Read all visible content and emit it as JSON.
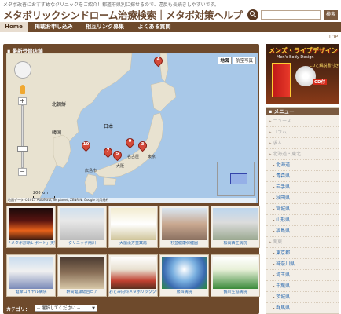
{
  "header": {
    "tagline": "メタボ改善におすすめなクリニックをご紹介！都道府県別に探せるので、違反も長続きしやすいです。",
    "site_title": "メタボリックシンドローム治療検索｜メタボ対策ヘルプ",
    "search": {
      "placeholder": "",
      "button_label": "検索"
    }
  },
  "nav": {
    "items": [
      {
        "label": "Home",
        "active": true
      },
      {
        "label": "掲載お申し込み",
        "active": false
      },
      {
        "label": "相互リンク募集",
        "active": false
      },
      {
        "label": "よくある質問",
        "active": false
      }
    ],
    "top_link": "TOP"
  },
  "main": {
    "panel_title": "最新登録店舗",
    "map": {
      "type_buttons": {
        "map": "地図",
        "satellite": "航空写真"
      },
      "labels": {
        "north_korea": "北朝鮮",
        "korea": "韓国",
        "japan": "日本",
        "tokyo": "東京",
        "osaka": "大阪",
        "nagoya": "名古屋",
        "hiroshima": "広島市"
      },
      "markers": [
        "4",
        "10",
        "7",
        "5",
        "9",
        "3"
      ],
      "scale": "200 km",
      "attribution": "地図データ ©2013 AutoNavi, SK planet, ZENRIN, Google 利用規約"
    },
    "thumbnails": [
      {
        "caption": "「メタボ診断レポート」美容ヘルス院"
      },
      {
        "caption": "クリニック南川"
      },
      {
        "caption": "大船漢方堂薬局"
      },
      {
        "caption": "杉並健康保健園"
      },
      {
        "caption": "松岡西生病院"
      },
      {
        "caption": "健幸ロイヤル病院"
      },
      {
        "caption": "幹高健康総合ビア"
      },
      {
        "caption": "おとみ内科メタボリッククリニック"
      },
      {
        "caption": "熊四病院"
      },
      {
        "caption": "鶴川生協病院"
      }
    ],
    "category": {
      "label": "カテゴリ：",
      "selected": "-- 選択してください --"
    }
  },
  "sidebar": {
    "banner": {
      "title": "メンズ・ライブデザイン",
      "subtitle": "Men's Body Design",
      "cd_label": "CDと解説書付き",
      "badge": "CD付"
    },
    "menu_title": "メニュー",
    "menu_items": [
      {
        "label": "ニュース",
        "level": 1
      },
      {
        "label": "コラム",
        "level": 1
      },
      {
        "label": "求人",
        "level": 1
      },
      {
        "label": "北海道・東北",
        "level": 1
      },
      {
        "label": "北海道",
        "level": 2
      },
      {
        "label": "青森県",
        "level": 2
      },
      {
        "label": "岩手県",
        "level": 2
      },
      {
        "label": "秋田県",
        "level": 2
      },
      {
        "label": "宮城県",
        "level": 2
      },
      {
        "label": "山形県",
        "level": 2
      },
      {
        "label": "福島県",
        "level": 2
      },
      {
        "label": "関東",
        "level": 1
      },
      {
        "label": "東京都",
        "level": 2
      },
      {
        "label": "神奈川県",
        "level": 2
      },
      {
        "label": "埼玉県",
        "level": 2
      },
      {
        "label": "千葉県",
        "level": 2
      },
      {
        "label": "茨城県",
        "level": 2
      },
      {
        "label": "群馬県",
        "level": 2
      }
    ]
  }
}
